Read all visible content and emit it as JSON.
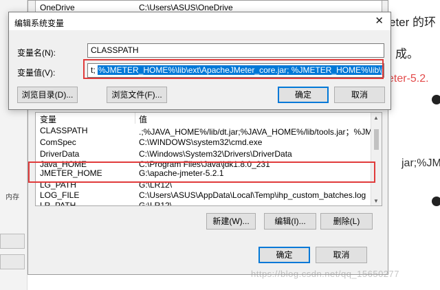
{
  "article": {
    "line1": "eter 的环",
    "line2": "成。",
    "line3": "eter-5.2.",
    "line4": "jar;%JMET",
    "left_tag": "内存"
  },
  "back_dialog": {
    "top_rows": [
      {
        "name": "OneDrive",
        "value": "C:\\Users\\ASUS\\OneDrive"
      }
    ],
    "list": {
      "header_name": "变量",
      "header_value": "值",
      "rows": [
        {
          "name": "CLASSPATH",
          "value": ".;%JAVA_HOME%/lib/dt.jar;%JAVA_HOME%/lib/tools.jar；%JME..."
        },
        {
          "name": "ComSpec",
          "value": "C:\\WINDOWS\\system32\\cmd.exe"
        },
        {
          "name": "DriverData",
          "value": "C:\\Windows\\System32\\Drivers\\DriverData"
        },
        {
          "name": "Java_HOME",
          "value": "C:\\Program Files\\Java\\jdk1.8.0_231"
        },
        {
          "name": "JMETER_HOME",
          "value": "G:\\apache-jmeter-5.2.1"
        },
        {
          "name": "LG_PATH",
          "value": "G:\\LR12\\"
        },
        {
          "name": "LOG_FILE",
          "value": "C:\\Users\\ASUS\\AppData\\Local\\Temp\\ihp_custom_batches.log"
        },
        {
          "name": "LR_PATH",
          "value": "G:\\LR12\\"
        }
      ]
    },
    "buttons": {
      "new": "新建(W)...",
      "edit": "编辑(I)...",
      "delete": "删除(L)",
      "ok": "确定",
      "cancel": "取消"
    }
  },
  "edit_dialog": {
    "title": "编辑系统变量",
    "close_glyph": "✕",
    "name_label": "变量名(N):",
    "name_value": "CLASSPATH",
    "value_label": "变量值(V):",
    "value_prefix": "t;",
    "value_selected": "%JMETER_HOME%\\lib\\ext\\ApacheJMeter_core.jar; %JMETER_HOME%\\lib\\jorphan.jar;",
    "buttons": {
      "browse_dir": "浏览目录(D)...",
      "browse_file": "浏览文件(F)...",
      "ok": "确定",
      "cancel": "取消"
    }
  },
  "watermark": "https://blog.csdn.net/qq_15650277",
  "colors": {
    "highlight": "#0078d7",
    "annotation": "#e03a3a"
  }
}
